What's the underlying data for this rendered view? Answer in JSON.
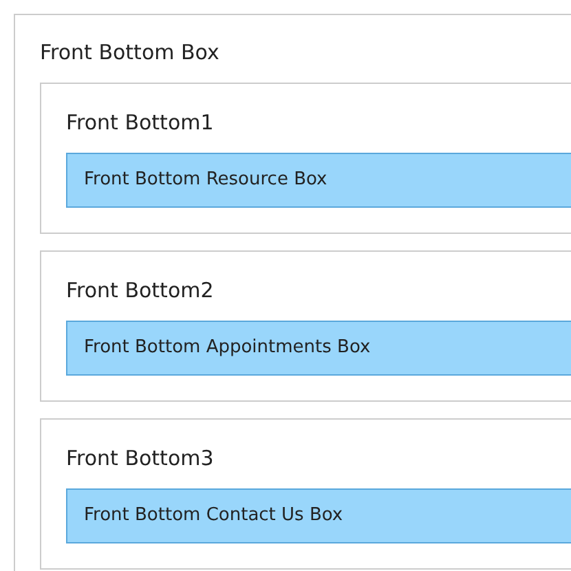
{
  "panel": {
    "title": "Front Bottom Box",
    "sections": [
      {
        "title": "Front Bottom1",
        "box": "Front Bottom Resource Box"
      },
      {
        "title": "Front Bottom2",
        "box": "Front Bottom Appointments Box"
      },
      {
        "title": "Front Bottom3",
        "box": "Front Bottom Contact Us Box"
      }
    ]
  }
}
